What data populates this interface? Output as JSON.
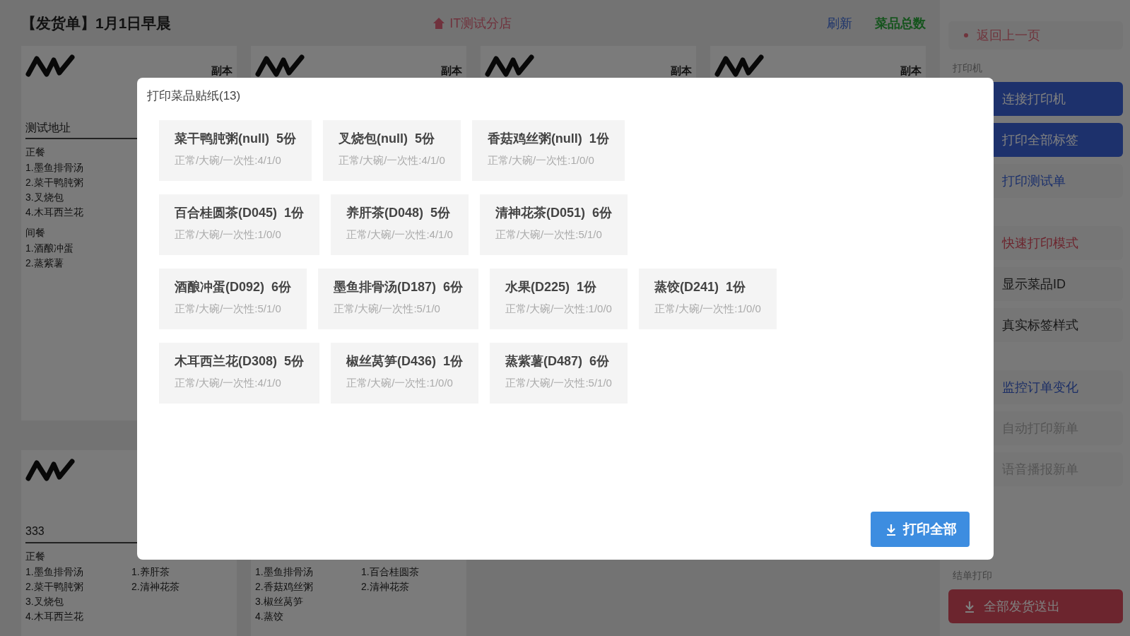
{
  "header": {
    "title": "【发货单】1月1日早晨",
    "shop": "IT测试分店",
    "refresh": "刷新",
    "dish_total": "菜品总数"
  },
  "order_rows": [
    [
      {
        "copy_label": "副本",
        "address": "测试地址",
        "columns": [
          {
            "sections": [
              {
                "header": "正餐",
                "items": [
                  "1.墨鱼排骨汤",
                  "2.菜干鸭肫粥",
                  "3.叉烧包",
                  "4.木耳西兰花"
                ]
              },
              {
                "header": "间餐",
                "items": [
                  "1.酒酿冲蛋",
                  "2.蒸紫薯"
                ]
              }
            ]
          }
        ]
      },
      {
        "copy_label": "副本"
      },
      {
        "copy_label": "副本"
      },
      {
        "copy_label": "副本"
      }
    ],
    [
      {
        "address": "333",
        "columns": [
          {
            "sections": [
              {
                "header": "正餐",
                "items": [
                  "1.墨鱼排骨汤",
                  "2.菜干鸭肫粥",
                  "3.叉烧包",
                  "4.木耳西兰花"
                ]
              }
            ]
          },
          {
            "sections": [
              {
                "items": [
                  "1.养肝茶",
                  "2.清神花茶"
                ]
              }
            ]
          }
        ]
      },
      {
        "columns": [
          {
            "sections": [
              {
                "items": [
                  "1.墨鱼排骨汤",
                  "2.香菇鸡丝粥",
                  "3.椒丝莴笋",
                  "4.蒸饺"
                ]
              }
            ]
          },
          {
            "sections": [
              {
                "items": [
                  "1.百合桂圆茶",
                  "2.清神花茶"
                ]
              }
            ]
          }
        ]
      }
    ]
  ],
  "sidebar": {
    "back": "返回上一页",
    "printer_label": "打印机",
    "connect": "连接打印机",
    "print_all_labels": "打印全部标签",
    "print_test": "打印测试单",
    "toggle_groups": [
      [
        {
          "label": "快速打印模式",
          "on": true,
          "disabled": false
        },
        {
          "label": "显示菜品ID",
          "on": false,
          "disabled": false
        },
        {
          "label": "真实标签样式",
          "on": false,
          "disabled": false
        }
      ],
      [
        {
          "label": "监控订单变化",
          "on": true,
          "disabled": false
        },
        {
          "label": "自动打印新单",
          "on": false,
          "disabled": true
        },
        {
          "label": "语音播报新单",
          "on": false,
          "disabled": true
        }
      ]
    ],
    "finish_label": "结单打印",
    "ship_all": "全部发货送出"
  },
  "modal": {
    "title": "打印菜品贴纸(13)",
    "print_all": "打印全部",
    "groups": [
      [
        {
          "name": "菜干鸭肫粥(null)  5份",
          "detail": "正常/大碗/一次性:4/1/0"
        },
        {
          "name": "叉烧包(null)  5份",
          "detail": "正常/大碗/一次性:4/1/0"
        },
        {
          "name": "香菇鸡丝粥(null)  1份",
          "detail": "正常/大碗/一次性:1/0/0"
        }
      ],
      [
        {
          "name": "百合桂圆茶(D045)  1份",
          "detail": "正常/大碗/一次性:1/0/0"
        },
        {
          "name": "养肝茶(D048)  5份",
          "detail": "正常/大碗/一次性:4/1/0"
        },
        {
          "name": "清神花茶(D051)  6份",
          "detail": "正常/大碗/一次性:5/1/0"
        }
      ],
      [
        {
          "name": "酒酿冲蛋(D092)  6份",
          "detail": "正常/大碗/一次性:5/1/0"
        },
        {
          "name": "墨鱼排骨汤(D187)  6份",
          "detail": "正常/大碗/一次性:5/1/0"
        },
        {
          "name": "水果(D225)  1份",
          "detail": "正常/大碗/一次性:1/0/0"
        },
        {
          "name": "蒸饺(D241)  1份",
          "detail": "正常/大碗/一次性:1/0/0"
        }
      ],
      [
        {
          "name": "木耳西兰花(D308)  5份",
          "detail": "正常/大碗/一次性:4/1/0"
        },
        {
          "name": "椒丝莴笋(D436)  1份",
          "detail": "正常/大碗/一次性:1/0/0"
        },
        {
          "name": "蒸紫薯(D487)  6份",
          "detail": "正常/大碗/一次性:5/1/0"
        }
      ]
    ]
  }
}
